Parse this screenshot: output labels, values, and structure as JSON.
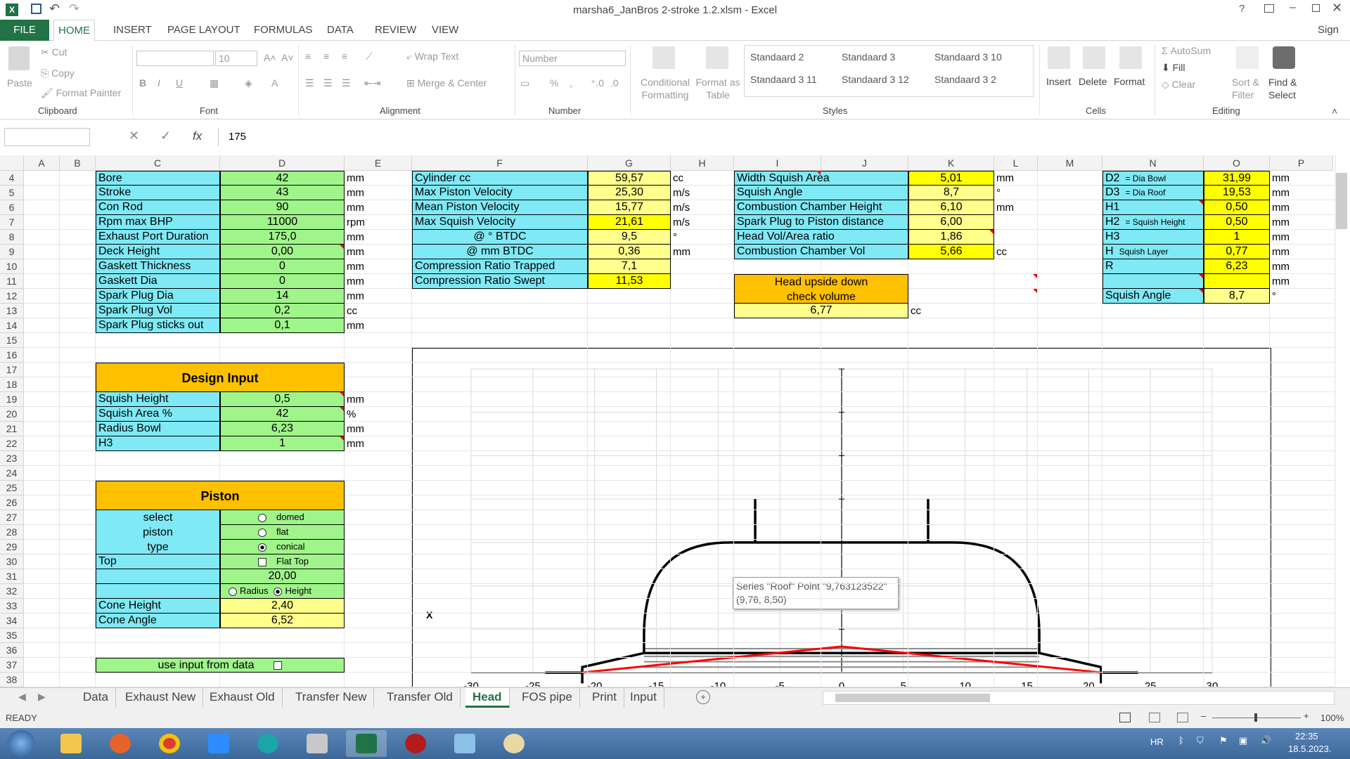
{
  "window": {
    "title": "marsha6_JanBros 2-stroke 1.2.xlsm - Excel",
    "sign_in": "Sign in"
  },
  "ribbon_tabs": [
    "FILE",
    "HOME",
    "INSERT",
    "PAGE LAYOUT",
    "FORMULAS",
    "DATA",
    "REVIEW",
    "VIEW"
  ],
  "clipboard": {
    "paste": "Paste",
    "cut": "Cut",
    "copy": "Copy",
    "format_painter": "Format Painter",
    "label": "Clipboard"
  },
  "font": {
    "size": "10",
    "label": "Font"
  },
  "alignment": {
    "wrap": "Wrap Text",
    "merge": "Merge & Center",
    "label": "Alignment"
  },
  "number": {
    "format": "Number",
    "label": "Number"
  },
  "styles": {
    "cond": "Conditional",
    "cond2": "Formatting",
    "fmt": "Format as",
    "fmt2": "Table",
    "items": [
      "Standaard 2",
      "Standaard 3",
      "Standaard 3 10",
      "Standaard 3 11",
      "Standaard 3 12",
      "Standaard 3 2"
    ],
    "label": "Styles"
  },
  "cells": {
    "insert": "Insert",
    "delete": "Delete",
    "format": "Format",
    "label": "Cells"
  },
  "editing": {
    "autosum": "AutoSum",
    "fill": "Fill",
    "clear": "Clear",
    "sort": "Sort &",
    "sort2": "Filter",
    "find": "Find &",
    "find2": "Select",
    "label": "Editing"
  },
  "formula_bar": {
    "name_box": "",
    "fx": "fx",
    "value": "175"
  },
  "columns": [
    "A",
    "B",
    "C",
    "D",
    "E",
    "F",
    "G",
    "H",
    "I",
    "J",
    "K",
    "L",
    "M",
    "N",
    "O",
    "P"
  ],
  "rows": [
    "4",
    "5",
    "6",
    "7",
    "8",
    "9",
    "10",
    "11",
    "12",
    "13",
    "14",
    "15",
    "16",
    "17",
    "18",
    "19",
    "20",
    "21",
    "22",
    "23",
    "24",
    "25",
    "26",
    "27",
    "28",
    "29",
    "30",
    "31",
    "32",
    "33",
    "34",
    "35",
    "36",
    "37",
    "38"
  ],
  "table_c": [
    [
      "Bore",
      "42",
      "mm"
    ],
    [
      "Stroke",
      "43",
      "mm"
    ],
    [
      "Con   Rod",
      "90",
      "mm"
    ],
    [
      "Rpm max BHP",
      "11000",
      "rpm"
    ],
    [
      "Exhaust Port Duration",
      "175,0",
      "mm"
    ],
    [
      "Deck   Height",
      "0,00",
      "mm"
    ],
    [
      "Gaskett   Thickness",
      "0",
      "mm"
    ],
    [
      "Gaskett   Dia",
      "0",
      "mm"
    ],
    [
      "Spark   Plug   Dia",
      "14",
      "mm"
    ],
    [
      "Spark   Plug   Vol",
      "0,2",
      "cc"
    ],
    [
      "Spark Plug sticks out",
      "0,1",
      "mm"
    ]
  ],
  "table_f": [
    [
      "Cylinder   cc",
      "59,57",
      "cc"
    ],
    [
      "Max   Piston   Velocity",
      "25,30",
      "m/s"
    ],
    [
      "Mean   Piston   Velocity",
      "15,77",
      "m/s"
    ],
    [
      "Max  Squish Velocity",
      "21,61",
      "m/s"
    ],
    [
      "@      °     BTDC",
      "9,5",
      "°"
    ],
    [
      "@      mm BTDC",
      "0,36",
      "mm"
    ],
    [
      "Compression   Ratio   Trapped",
      "7,1",
      ""
    ],
    [
      "Compression   Ratio   Swept",
      "11,53",
      ""
    ]
  ],
  "table_i": [
    [
      "Width   Squish   Area",
      "5,01",
      "mm"
    ],
    [
      "Squish   Angle",
      "8,7",
      "°"
    ],
    [
      "Combustion   Chamber   Height",
      "6,10",
      "mm"
    ],
    [
      "Spark Plug to Piston distance",
      "6,00",
      ""
    ],
    [
      "Head   Vol/Area   ratio",
      "1,86",
      ""
    ],
    [
      "Combustion   Chamber   Vol",
      "5,66",
      "cc"
    ]
  ],
  "head_check": {
    "line1": "Head upside down",
    "line2": "check volume",
    "value": "6,77",
    "unit": "cc"
  },
  "table_n": [
    [
      "D2",
      "= Dia Bowl",
      "31,99",
      "mm"
    ],
    [
      "D3",
      "= Dia Roof",
      "19,53",
      "mm"
    ],
    [
      "H1",
      "",
      "0,50",
      "mm"
    ],
    [
      "H2",
      "= Squish Height",
      "0,50",
      "mm"
    ],
    [
      "H3",
      "",
      "1",
      "mm"
    ],
    [
      "H",
      "Squish Layer",
      "0,77",
      "mm"
    ],
    [
      "R",
      "",
      "6,23",
      "mm"
    ],
    [
      "",
      "",
      "",
      "mm"
    ],
    [
      "Squish Angle",
      "",
      "8,7",
      "°"
    ]
  ],
  "design_input": {
    "title": "Design Input",
    "rows": [
      [
        "Squish   Height",
        "0,5",
        "mm"
      ],
      [
        "Squish   Area    %",
        "42",
        "%"
      ],
      [
        "Radius   Bowl",
        "6,23",
        "mm"
      ],
      [
        "H3",
        "1",
        "mm"
      ]
    ]
  },
  "piston": {
    "title": "Piston",
    "select": "select",
    "piston": "piston",
    "type": "type",
    "opt_domed": "domed",
    "opt_flat": "flat",
    "opt_conical": "conical",
    "top": "Top",
    "flat_top": "Flat Top",
    "value_20": "20,00",
    "radius": "Radius",
    "height": "Height",
    "cone_height_label": "Cone Height",
    "cone_height": "2,40",
    "cone_angle_label": "Cone Angle",
    "cone_angle": "6,52",
    "use_input": "use input from data"
  },
  "chart": {
    "x_label": "X",
    "tooltip1": "Series \"Roof\" Point \"9,763123522\"",
    "tooltip2": "(9,76, 8,50)"
  },
  "chart_data": {
    "type": "line",
    "x_ticks": [
      "-30",
      "-25",
      "-20",
      "-15",
      "-10",
      "-5",
      "0",
      "5",
      "10",
      "15",
      "20",
      "25",
      "30"
    ],
    "xlim": [
      -30,
      30
    ],
    "series": [
      {
        "name": "Roof",
        "x": [
          -24,
          -21,
          -21,
          -16,
          -16,
          -11,
          -7,
          7,
          11,
          16,
          16,
          21,
          21,
          24
        ],
        "y": [
          0,
          0,
          0.5,
          0.5,
          1.5,
          5,
          5.5,
          5.5,
          5,
          1.5,
          0.5,
          0.5,
          0,
          0
        ],
        "color": "#000000"
      },
      {
        "name": "Piston",
        "x": [
          -21,
          0,
          21
        ],
        "y": [
          0,
          1.5,
          0
        ],
        "color": "#ff0000"
      }
    ]
  },
  "sheet_tabs": [
    "Data",
    "Exhaust New",
    "Exhaust Old",
    "Transfer New",
    "Transfer Old",
    "Head",
    "FOS pipe",
    "Print",
    "Input"
  ],
  "status": {
    "ready": "READY",
    "zoom": "100%"
  },
  "taskbar": {
    "lang": "HR",
    "time": "22:35",
    "date": "18.5.2023."
  }
}
